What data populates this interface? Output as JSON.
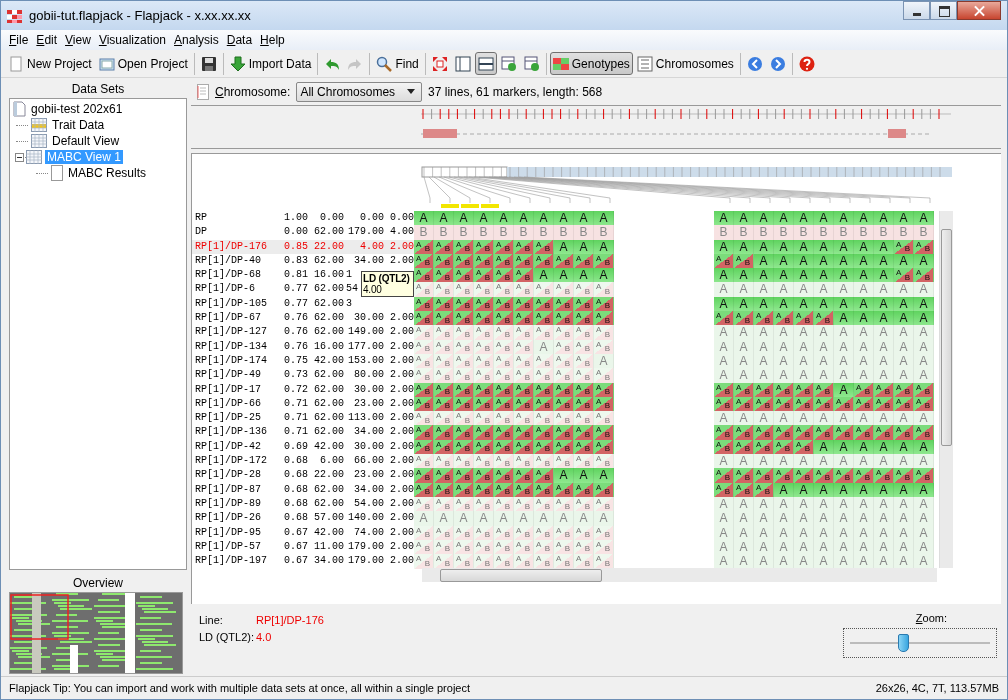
{
  "window": {
    "title": "gobii-tut.flapjack - Flapjack - x.xx.xx.xx"
  },
  "menu": [
    "File",
    "Edit",
    "View",
    "Visualization",
    "Analysis",
    "Data",
    "Help"
  ],
  "toolbar": [
    {
      "kind": "button",
      "label": "New Project"
    },
    {
      "kind": "button",
      "label": "Open Project"
    },
    {
      "kind": "separator"
    },
    {
      "kind": "icon"
    },
    {
      "kind": "separator"
    },
    {
      "kind": "button",
      "label": "Import Data"
    },
    {
      "kind": "separator"
    },
    {
      "kind": "icon",
      "disabled": false
    },
    {
      "kind": "icon",
      "disabled": true
    },
    {
      "kind": "separator"
    },
    {
      "kind": "button",
      "label": "Find"
    },
    {
      "kind": "separator"
    },
    {
      "kind": "icon",
      "selected": false
    },
    {
      "kind": "icon",
      "selected": false
    },
    {
      "kind": "icon",
      "selected": true
    },
    {
      "kind": "icon",
      "selected": false
    },
    {
      "kind": "icon",
      "selected": false
    },
    {
      "kind": "separator"
    },
    {
      "kind": "button",
      "label": "Genotypes",
      "selected": true
    },
    {
      "kind": "button",
      "label": "Chromosomes",
      "selected": false
    },
    {
      "kind": "separator"
    },
    {
      "kind": "icon"
    },
    {
      "kind": "icon"
    },
    {
      "kind": "separator"
    },
    {
      "kind": "icon"
    }
  ],
  "data_sets": {
    "title": "Data Sets",
    "root": {
      "label": "gobii-test 202x61",
      "children": [
        {
          "label": "Trait Data",
          "selected": false
        },
        {
          "label": "Default View",
          "selected": false
        },
        {
          "label": "MABC View 1",
          "selected": true,
          "expanded": true,
          "children": [
            {
              "label": "MABC Results",
              "selected": false
            }
          ]
        }
      ]
    }
  },
  "overview": {
    "title": "Overview"
  },
  "chromosome_bar": {
    "label": "Chromosome:",
    "value": "All Chromosomes",
    "summary": "37 lines, 61 markers, length: 568"
  },
  "lines": [
    {
      "name": "RP",
      "values": [
        "1.00",
        "0.00",
        "0.00",
        "0.00"
      ],
      "selected": false,
      "dimmed": false,
      "kind": "recurrent",
      "left": [
        "A",
        "A",
        "A",
        "A",
        "A",
        "A",
        "A",
        "A",
        "A",
        "A"
      ],
      "right": [
        "A",
        "A",
        "A",
        "A",
        "A",
        "A",
        "A",
        "A",
        "A",
        "A",
        "A"
      ]
    },
    {
      "name": "DP",
      "values": [
        "0.00",
        "62.00",
        "179.00",
        "4.00"
      ],
      "selected": false,
      "dimmed": false,
      "kind": "donor",
      "left": [
        "B",
        "B",
        "B",
        "B",
        "B",
        "B",
        "B",
        "B",
        "B",
        "B"
      ],
      "right": [
        "B",
        "B",
        "B",
        "B",
        "B",
        "B",
        "B",
        "B",
        "B",
        "B",
        "B"
      ]
    },
    {
      "name": "RP[1]/DP-176",
      "values": [
        "0.85",
        "22.00",
        "4.00",
        "2.00"
      ],
      "selected": true,
      "dimmed": false,
      "kind": "recurrent",
      "left": [
        [
          "A",
          "B"
        ],
        [
          "A",
          "B"
        ],
        [
          "A",
          "B"
        ],
        [
          "A",
          "B"
        ],
        [
          "A",
          "B"
        ],
        [
          "A",
          "B"
        ],
        [
          "A",
          "B"
        ],
        "A",
        "A",
        "A"
      ],
      "right": [
        "A",
        "A",
        "A",
        "A",
        "A",
        "A",
        "A",
        "A",
        "A",
        [
          "A",
          "B"
        ],
        [
          "A",
          "B"
        ]
      ]
    },
    {
      "name": "RP[1]/DP-40",
      "values": [
        "0.83",
        "62.00",
        "34.00",
        "2.00"
      ],
      "selected": false,
      "dimmed": false,
      "kind": "recurrent",
      "left": [
        [
          "A",
          "B"
        ],
        [
          "A",
          "B"
        ],
        [
          "A",
          "B"
        ],
        [
          "A",
          "B"
        ],
        [
          "A",
          "B"
        ],
        [
          "A",
          "B"
        ],
        [
          "A",
          "B"
        ],
        [
          "A",
          "B"
        ],
        [
          "A",
          "B"
        ],
        [
          "A",
          "B"
        ]
      ],
      "right": [
        [
          "A",
          "B"
        ],
        [
          "A",
          "B"
        ],
        "A",
        "A",
        "A",
        "A",
        "A",
        "A",
        "A",
        "A",
        "A"
      ]
    },
    {
      "name": "RP[1]/DP-68",
      "values": [
        "0.81",
        "16.00",
        "1"
      ],
      "selected": false,
      "dimmed": false,
      "kind": "recurrent",
      "left": [
        [
          "A",
          "B"
        ],
        [
          "A",
          "B"
        ],
        [
          "A",
          "B"
        ],
        [
          "A",
          "B"
        ],
        [
          "A",
          "B"
        ],
        [
          "A",
          "B"
        ],
        "A",
        "A",
        "A",
        "A"
      ],
      "right": [
        "A",
        "A",
        "A",
        "A",
        "A",
        "A",
        "A",
        "A",
        "A",
        [
          "A",
          "B"
        ],
        [
          "A",
          "B"
        ]
      ]
    },
    {
      "name": "RP[1]/DP-6",
      "values": [
        "0.77",
        "62.00",
        "54"
      ],
      "selected": false,
      "dimmed": true,
      "kind": "recurrent",
      "left": [
        [
          "A",
          "B"
        ],
        [
          "A",
          "B"
        ],
        [
          "A",
          "B"
        ],
        [
          "A",
          "B"
        ],
        [
          "A",
          "B"
        ],
        [
          "A",
          "B"
        ],
        [
          "A",
          "B"
        ],
        [
          "A",
          "B"
        ],
        [
          "A",
          "B"
        ],
        [
          "A",
          "B"
        ]
      ],
      "right": [
        "A",
        "A",
        "A",
        "A",
        "A",
        "A",
        "A",
        "A",
        "A",
        "A",
        "A"
      ]
    },
    {
      "name": "RP[1]/DP-105",
      "values": [
        "0.77",
        "62.00",
        "3"
      ],
      "selected": false,
      "dimmed": false,
      "kind": "recurrent",
      "left": [
        [
          "A",
          "B"
        ],
        [
          "A",
          "B"
        ],
        [
          "A",
          "B"
        ],
        [
          "A",
          "B"
        ],
        [
          "A",
          "B"
        ],
        [
          "A",
          "B"
        ],
        [
          "A",
          "B"
        ],
        [
          "A",
          "B"
        ],
        [
          "A",
          "B"
        ],
        [
          "A",
          "B"
        ]
      ],
      "right": [
        "A",
        "A",
        "A",
        "A",
        "A",
        "A",
        "A",
        "A",
        "A",
        "A",
        "A"
      ]
    },
    {
      "name": "RP[1]/DP-67",
      "values": [
        "0.76",
        "62.00",
        "30.00",
        "2.00"
      ],
      "selected": false,
      "dimmed": false,
      "kind": "recurrent",
      "left": [
        [
          "A",
          "B"
        ],
        [
          "A",
          "B"
        ],
        [
          "A",
          "B"
        ],
        [
          "A",
          "B"
        ],
        [
          "A",
          "B"
        ],
        [
          "A",
          "B"
        ],
        [
          "A",
          "B"
        ],
        [
          "A",
          "B"
        ],
        [
          "A",
          "B"
        ],
        [
          "A",
          "B"
        ]
      ],
      "right": [
        [
          "A",
          "B"
        ],
        [
          "A",
          "B"
        ],
        [
          "A",
          "B"
        ],
        [
          "A",
          "B"
        ],
        [
          "A",
          "B"
        ],
        [
          "A",
          "B"
        ],
        "A",
        "A",
        "A",
        "A",
        "A"
      ]
    },
    {
      "name": "RP[1]/DP-127",
      "values": [
        "0.76",
        "62.00",
        "149.00",
        "2.00"
      ],
      "selected": false,
      "dimmed": true,
      "kind": "recurrent",
      "left": [
        [
          "A",
          "B"
        ],
        [
          "A",
          "B"
        ],
        [
          "A",
          "B"
        ],
        [
          "A",
          "B"
        ],
        [
          "A",
          "B"
        ],
        [
          "A",
          "B"
        ],
        [
          "A",
          "B"
        ],
        [
          "A",
          "B"
        ],
        [
          "A",
          "B"
        ],
        [
          "A",
          "B"
        ]
      ],
      "right": [
        "A",
        "A",
        "A",
        "A",
        "A",
        "A",
        "A",
        "A",
        "A",
        "A",
        "A"
      ]
    },
    {
      "name": "RP[1]/DP-134",
      "values": [
        "0.76",
        "16.00",
        "177.00",
        "2.00"
      ],
      "selected": false,
      "dimmed": true,
      "kind": "recurrent",
      "left": [
        [
          "A",
          "B"
        ],
        [
          "A",
          "B"
        ],
        [
          "A",
          "B"
        ],
        [
          "A",
          "B"
        ],
        [
          "A",
          "B"
        ],
        [
          "A",
          "B"
        ],
        "A",
        [
          "A",
          "B"
        ],
        [
          "A",
          "B"
        ],
        [
          "A",
          "B"
        ]
      ],
      "right": [
        "A",
        "A",
        "A",
        "A",
        "A",
        "A",
        "A",
        "A",
        "A",
        "A",
        "A"
      ]
    },
    {
      "name": "RP[1]/DP-174",
      "values": [
        "0.75",
        "42.00",
        "153.00",
        "2.00"
      ],
      "selected": false,
      "dimmed": true,
      "kind": "recurrent",
      "left": [
        [
          "A",
          "B"
        ],
        [
          "A",
          "B"
        ],
        [
          "A",
          "B"
        ],
        [
          "A",
          "B"
        ],
        [
          "A",
          "B"
        ],
        [
          "A",
          "B"
        ],
        [
          "A",
          "B"
        ],
        [
          "A",
          "B"
        ],
        [
          "A",
          "B"
        ],
        "A"
      ],
      "right": [
        "A",
        "A",
        "A",
        "A",
        "A",
        "A",
        "A",
        "A",
        "A",
        "A",
        "A"
      ]
    },
    {
      "name": "RP[1]/DP-49",
      "values": [
        "0.73",
        "62.00",
        "80.00",
        "2.00"
      ],
      "selected": false,
      "dimmed": true,
      "kind": "recurrent",
      "left": [
        [
          "A",
          "B"
        ],
        [
          "A",
          "B"
        ],
        [
          "A",
          "B"
        ],
        [
          "A",
          "B"
        ],
        [
          "A",
          "B"
        ],
        [
          "A",
          "B"
        ],
        [
          "A",
          "B"
        ],
        [
          "A",
          "B"
        ],
        [
          "A",
          "B"
        ],
        [
          "A",
          "B"
        ]
      ],
      "right": [
        "A",
        "A",
        "A",
        "A",
        "A",
        "A",
        "A",
        "A",
        "A",
        "A",
        "A"
      ]
    },
    {
      "name": "RP[1]/DP-17",
      "values": [
        "0.72",
        "62.00",
        "30.00",
        "2.00"
      ],
      "selected": false,
      "dimmed": false,
      "kind": "recurrent",
      "left": [
        [
          "A",
          "B"
        ],
        [
          "A",
          "B"
        ],
        [
          "A",
          "B"
        ],
        [
          "A",
          "B"
        ],
        [
          "A",
          "B"
        ],
        [
          "A",
          "B"
        ],
        [
          "A",
          "B"
        ],
        [
          "A",
          "B"
        ],
        [
          "A",
          "B"
        ],
        [
          "A",
          "B"
        ]
      ],
      "right": [
        [
          "A",
          "B"
        ],
        [
          "A",
          "B"
        ],
        [
          "A",
          "B"
        ],
        [
          "A",
          "B"
        ],
        [
          "A",
          "B"
        ],
        [
          "A",
          "B"
        ],
        "A",
        [
          "A",
          "B"
        ],
        [
          "A",
          "B"
        ],
        [
          "A",
          "B"
        ],
        [
          "A",
          "B"
        ]
      ]
    },
    {
      "name": "RP[1]/DP-66",
      "values": [
        "0.71",
        "62.00",
        "23.00",
        "2.00"
      ],
      "selected": false,
      "dimmed": false,
      "kind": "recurrent",
      "left": [
        [
          "A",
          "B"
        ],
        [
          "A",
          "B"
        ],
        [
          "A",
          "B"
        ],
        [
          "A",
          "B"
        ],
        [
          "A",
          "B"
        ],
        [
          "A",
          "B"
        ],
        [
          "A",
          "B"
        ],
        [
          "A",
          "B"
        ],
        [
          "A",
          "B"
        ],
        [
          "A",
          "B"
        ]
      ],
      "right": [
        [
          "A",
          "B"
        ],
        [
          "A",
          "B"
        ],
        [
          "A",
          "B"
        ],
        [
          "A",
          "B"
        ],
        [
          "A",
          "B"
        ],
        [
          "A",
          "B"
        ],
        [
          "A",
          "B"
        ],
        [
          "A",
          "B"
        ],
        [
          "A",
          "B"
        ],
        [
          "A",
          "B"
        ],
        [
          "A",
          "B"
        ]
      ]
    },
    {
      "name": "RP[1]/DP-25",
      "values": [
        "0.71",
        "62.00",
        "113.00",
        "2.00"
      ],
      "selected": false,
      "dimmed": true,
      "kind": "recurrent",
      "left": [
        [
          "A",
          "B"
        ],
        [
          "A",
          "B"
        ],
        [
          "A",
          "B"
        ],
        [
          "A",
          "B"
        ],
        [
          "A",
          "B"
        ],
        [
          "A",
          "B"
        ],
        [
          "A",
          "B"
        ],
        [
          "A",
          "B"
        ],
        [
          "A",
          "B"
        ],
        [
          "A",
          "B"
        ]
      ],
      "right": [
        "A",
        "A",
        "A",
        "A",
        "A",
        "A",
        "A",
        "A",
        "A",
        "A",
        "A"
      ]
    },
    {
      "name": "RP[1]/DP-136",
      "values": [
        "0.71",
        "62.00",
        "34.00",
        "2.00"
      ],
      "selected": false,
      "dimmed": false,
      "kind": "recurrent",
      "left": [
        [
          "A",
          "B"
        ],
        [
          "A",
          "B"
        ],
        [
          "A",
          "B"
        ],
        [
          "A",
          "B"
        ],
        [
          "A",
          "B"
        ],
        [
          "A",
          "B"
        ],
        [
          "A",
          "B"
        ],
        [
          "A",
          "B"
        ],
        [
          "A",
          "B"
        ],
        [
          "A",
          "B"
        ]
      ],
      "right": [
        [
          "A",
          "B"
        ],
        [
          "A",
          "B"
        ],
        [
          "A",
          "B"
        ],
        [
          "A",
          "B"
        ],
        [
          "A",
          "B"
        ],
        [
          "A",
          "B"
        ],
        [
          "A",
          "B"
        ],
        [
          "A",
          "B"
        ],
        [
          "A",
          "B"
        ],
        [
          "A",
          "B"
        ],
        [
          "A",
          "B"
        ]
      ]
    },
    {
      "name": "RP[1]/DP-42",
      "values": [
        "0.69",
        "42.00",
        "30.00",
        "2.00"
      ],
      "selected": false,
      "dimmed": false,
      "kind": "recurrent",
      "left": [
        [
          "A",
          "B"
        ],
        [
          "A",
          "B"
        ],
        [
          "A",
          "B"
        ],
        [
          "A",
          "B"
        ],
        [
          "A",
          "B"
        ],
        [
          "A",
          "B"
        ],
        [
          "A",
          "B"
        ],
        [
          "A",
          "B"
        ],
        [
          "A",
          "B"
        ],
        [
          "A",
          "B"
        ]
      ],
      "right": [
        [
          "A",
          "B"
        ],
        [
          "A",
          "B"
        ],
        [
          "A",
          "B"
        ],
        [
          "A",
          "B"
        ],
        [
          "A",
          "B"
        ],
        "A",
        "A",
        "A",
        "A",
        "A",
        "A"
      ]
    },
    {
      "name": "RP[1]/DP-172",
      "values": [
        "0.68",
        "6.00",
        "66.00",
        "2.00"
      ],
      "selected": false,
      "dimmed": true,
      "kind": "recurrent",
      "left": [
        [
          "A",
          "B"
        ],
        [
          "A",
          "B"
        ],
        [
          "A",
          "B"
        ],
        [
          "A",
          "B"
        ],
        [
          "A",
          "B"
        ],
        [
          "A",
          "B"
        ],
        [
          "A",
          "B"
        ],
        [
          "A",
          "B"
        ],
        [
          "A",
          "B"
        ],
        [
          "A",
          "B"
        ]
      ],
      "right": [
        "A",
        "A",
        "A",
        "A",
        "A",
        "A",
        "A",
        "A",
        "A",
        "A",
        "A"
      ]
    },
    {
      "name": "RP[1]/DP-28",
      "values": [
        "0.68",
        "22.00",
        "23.00",
        "2.00"
      ],
      "selected": false,
      "dimmed": false,
      "kind": "recurrent",
      "left": [
        [
          "A",
          "B"
        ],
        [
          "A",
          "B"
        ],
        [
          "A",
          "B"
        ],
        [
          "A",
          "B"
        ],
        [
          "A",
          "B"
        ],
        [
          "A",
          "B"
        ],
        [
          "A",
          "B"
        ],
        "A",
        "A",
        "A"
      ],
      "right": [
        [
          "A",
          "B"
        ],
        [
          "A",
          "B"
        ],
        [
          "A",
          "B"
        ],
        [
          "A",
          "B"
        ],
        [
          "A",
          "B"
        ],
        [
          "A",
          "B"
        ],
        [
          "A",
          "B"
        ],
        [
          "A",
          "B"
        ],
        [
          "A",
          "B"
        ],
        [
          "A",
          "B"
        ],
        [
          "A",
          "B"
        ]
      ]
    },
    {
      "name": "RP[1]/DP-87",
      "values": [
        "0.68",
        "62.00",
        "34.00",
        "2.00"
      ],
      "selected": false,
      "dimmed": false,
      "kind": "recurrent",
      "left": [
        [
          "A",
          "B"
        ],
        [
          "A",
          "B"
        ],
        [
          "A",
          "B"
        ],
        [
          "A",
          "B"
        ],
        [
          "A",
          "B"
        ],
        [
          "A",
          "B"
        ],
        [
          "A",
          "B"
        ],
        [
          "A",
          "B"
        ],
        [
          "A",
          "B"
        ],
        [
          "A",
          "B"
        ]
      ],
      "right": [
        [
          "A",
          "B"
        ],
        [
          "A",
          "B"
        ],
        [
          "A",
          "B"
        ],
        "A",
        "A",
        "A",
        "A",
        "A",
        "A",
        "A",
        "A"
      ]
    },
    {
      "name": "RP[1]/DP-89",
      "values": [
        "0.68",
        "62.00",
        "54.00",
        "2.00"
      ],
      "selected": false,
      "dimmed": true,
      "kind": "recurrent",
      "left": [
        [
          "A",
          "B"
        ],
        [
          "A",
          "B"
        ],
        [
          "A",
          "B"
        ],
        [
          "A",
          "B"
        ],
        [
          "A",
          "B"
        ],
        [
          "A",
          "B"
        ],
        [
          "A",
          "B"
        ],
        [
          "A",
          "B"
        ],
        [
          "A",
          "B"
        ],
        [
          "A",
          "B"
        ]
      ],
      "right": [
        "A",
        "A",
        "A",
        "A",
        "A",
        "A",
        "A",
        "A",
        "A",
        "A",
        "A"
      ]
    },
    {
      "name": "RP[1]/DP-26",
      "values": [
        "0.68",
        "57.00",
        "140.00",
        "2.00"
      ],
      "selected": false,
      "dimmed": true,
      "kind": "recurrent",
      "left": [
        "A",
        "A",
        "A",
        "A",
        "A",
        "A",
        "A",
        "A",
        "A",
        "A"
      ],
      "right": [
        "A",
        "A",
        "A",
        "A",
        "A",
        "A",
        "A",
        "A",
        "A",
        "A",
        "A"
      ]
    },
    {
      "name": "RP[1]/DP-95",
      "values": [
        "0.67",
        "42.00",
        "74.00",
        "2.00"
      ],
      "selected": false,
      "dimmed": true,
      "kind": "recurrent",
      "left": [
        [
          "A",
          "B"
        ],
        [
          "A",
          "B"
        ],
        [
          "A",
          "B"
        ],
        [
          "A",
          "B"
        ],
        [
          "A",
          "B"
        ],
        [
          "A",
          "B"
        ],
        [
          "A",
          "B"
        ],
        [
          "A",
          "B"
        ],
        [
          "A",
          "B"
        ],
        [
          "A",
          "B"
        ]
      ],
      "right": [
        "A",
        "A",
        "A",
        "A",
        "A",
        "A",
        "A",
        "A",
        "A",
        "A",
        "A"
      ]
    },
    {
      "name": "RP[1]/DP-57",
      "values": [
        "0.67",
        "11.00",
        "179.00",
        "2.00"
      ],
      "selected": false,
      "dimmed": true,
      "kind": "recurrent",
      "left": [
        [
          "A",
          "B"
        ],
        [
          "A",
          "B"
        ],
        [
          "A",
          "B"
        ],
        [
          "A",
          "B"
        ],
        [
          "A",
          "B"
        ],
        [
          "A",
          "B"
        ],
        [
          "A",
          "B"
        ],
        [
          "A",
          "B"
        ],
        [
          "A",
          "B"
        ],
        [
          "A",
          "B"
        ]
      ],
      "right": [
        "A",
        "A",
        "A",
        "A",
        "A",
        "A",
        "A",
        "A",
        "A",
        "A",
        "A"
      ]
    },
    {
      "name": "RP[1]/DP-197",
      "values": [
        "0.67",
        "34.00",
        "179.00",
        "2.00"
      ],
      "selected": false,
      "dimmed": true,
      "kind": "recurrent",
      "left": [
        [
          "A",
          "B"
        ],
        [
          "A",
          "B"
        ],
        [
          "A",
          "B"
        ],
        [
          "A",
          "B"
        ],
        [
          "A",
          "B"
        ],
        [
          "A",
          "B"
        ],
        [
          "A",
          "B"
        ],
        [
          "A",
          "B"
        ],
        [
          "A",
          "B"
        ],
        [
          "A",
          "B"
        ]
      ],
      "right": [
        "A",
        "A",
        "A",
        "A",
        "A",
        "A",
        "A",
        "A",
        "A",
        "A",
        "A"
      ]
    }
  ],
  "tooltip": {
    "title": "LD (QTL2)",
    "value": "4.00"
  },
  "details": [
    {
      "label": "Line:",
      "value": "RP[1]/DP-176"
    },
    {
      "label": "LD (QTL2):",
      "value": "4.0"
    }
  ],
  "zoom": {
    "label": "Zoom:",
    "level": 0.38
  },
  "status": {
    "tip": "Flapjack Tip:  You can import and work with multiple data sets at once, all within a single project",
    "memory": "26x26, 4C, 7T, 113.57MB"
  }
}
